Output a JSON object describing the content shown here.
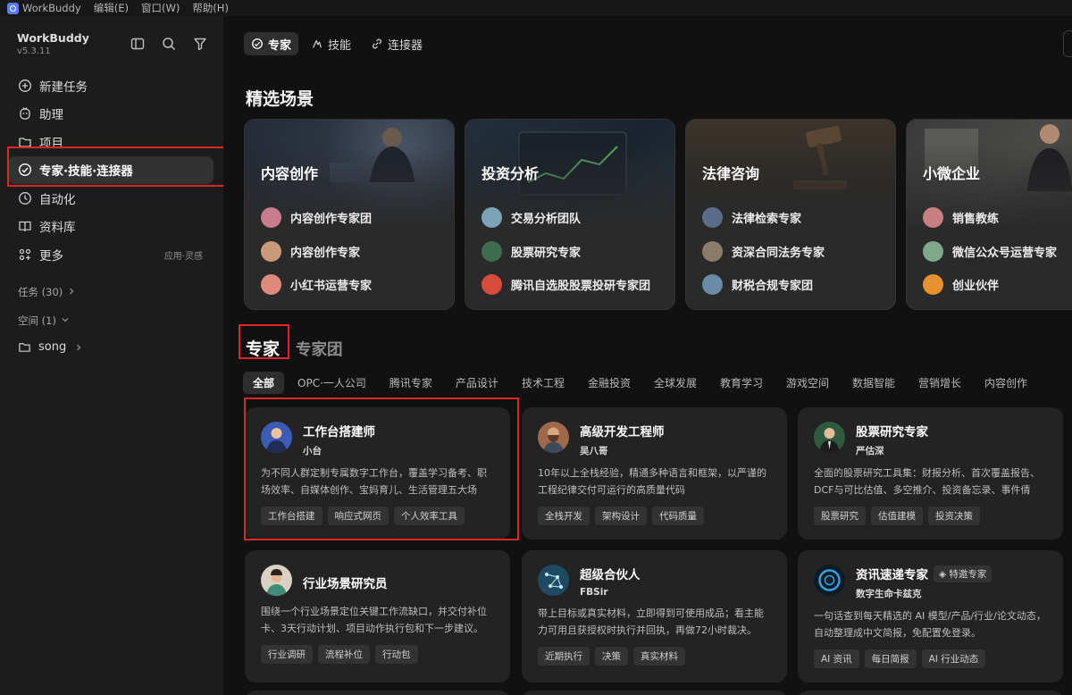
{
  "menubar": {
    "app": "WorkBuddy",
    "items": [
      "编辑(E)",
      "窗口(W)",
      "帮助(H)"
    ]
  },
  "sidebar": {
    "brand": "WorkBuddy",
    "version": "v5.3.11",
    "nav": [
      {
        "label": "新建任务",
        "icon": "plus-circle-icon"
      },
      {
        "label": "助理",
        "icon": "assistant-icon"
      },
      {
        "label": "项目",
        "icon": "folder-icon"
      },
      {
        "label": "专家·技能·连接器",
        "icon": "expert-icon",
        "active": true
      },
      {
        "label": "自动化",
        "icon": "clock-icon"
      },
      {
        "label": "资料库",
        "icon": "book-icon"
      },
      {
        "label": "更多",
        "icon": "grid-icon",
        "extra": "应用·灵感"
      }
    ],
    "tasks_label": "任务 (30)",
    "spaces_label": "空间 (1)",
    "folder": "song"
  },
  "tabs": [
    {
      "label": "专家",
      "active": true
    },
    {
      "label": "技能"
    },
    {
      "label": "连接器"
    }
  ],
  "featured_heading": "精选场景",
  "scenes": [
    {
      "title": "内容创作",
      "rows": [
        "内容创作专家团",
        "内容创作专家",
        "小红书运营专家"
      ],
      "colors": [
        "#c77d8d",
        "#c99a7a",
        "#e08a7a"
      ]
    },
    {
      "title": "投资分析",
      "rows": [
        "交易分析团队",
        "股票研究专家",
        "腾讯自选股股票投研专家团"
      ],
      "colors": [
        "#7da3b8",
        "#3f6b4e",
        "#d84a3a"
      ]
    },
    {
      "title": "法律咨询",
      "rows": [
        "法律检索专家",
        "资深合同法务专家",
        "财税合规专家团"
      ],
      "colors": [
        "#5a6d88",
        "#8b7b6a",
        "#6b8aa8"
      ]
    },
    {
      "title": "小微企业",
      "rows": [
        "销售教练",
        "微信公众号运营专家",
        "创业伙伴"
      ],
      "colors": [
        "#c87f7f",
        "#7ea88a",
        "#e6912e"
      ]
    }
  ],
  "experts_heading": "专家",
  "teams_heading": "专家团",
  "categories": [
    "全部",
    "OPC·一人公司",
    "腾讯专家",
    "产品设计",
    "技术工程",
    "金融投资",
    "全球发展",
    "教育学习",
    "游戏空间",
    "数据智能",
    "营销增长",
    "内容创作"
  ],
  "cards": [
    {
      "name": "工作台搭建师",
      "sub": "小台",
      "desc": "为不同人群定制专属数字工作台，覆盖学习备考、职场效率、自媒体创作、宝妈育儿、生活管理五大场景，…",
      "tags": [
        "工作台搭建",
        "响应式网页",
        "个人效率工具"
      ],
      "avatar_color": "#3b5bb5"
    },
    {
      "name": "高级开发工程师",
      "sub": "吴八哥",
      "desc": "10年以上全栈经验，精通多种语言和框架，以严谨的工程纪律交付可运行的高质量代码",
      "tags": [
        "全栈开发",
        "架构设计",
        "代码质量"
      ],
      "avatar_color": "#a0694a"
    },
    {
      "name": "股票研究专家",
      "sub": "严估深",
      "desc": "全面的股票研究工具集：财报分析、首次覆盖报告、DCF与可比估值、多空推介、投资备忘录、事件倩景…",
      "tags": [
        "股票研究",
        "估值建模",
        "投资决策"
      ],
      "avatar_color": "#2f5a40"
    },
    {
      "name": "行业场景研究员",
      "sub": "",
      "desc": "围绕一个行业场景定位关键工作流缺口，并交付补位卡、3天行动计划、项目动作执行包和下一步建议。",
      "tags": [
        "行业调研",
        "流程补位",
        "行动包"
      ],
      "avatar_color": "#3f8c7a"
    },
    {
      "name": "超级合伙人",
      "sub": "FBSir",
      "desc": "带上目标或真实材料，立即得到可使用成品；看主能力可用且获授权时执行并回执，再做72小时裁决。",
      "tags": [
        "近期执行",
        "决策",
        "真实材料"
      ],
      "avatar_color": "#1f4a63"
    },
    {
      "name": "资讯速递专家",
      "sub": "数字生命卡兹克",
      "badge": "特邀专家",
      "desc": "一句话查到每天精选的 AI 模型/产品/行业/论文动态，自动整理成中文简报，免配置免登录。",
      "tags": [
        "AI 资讯",
        "每日简报",
        "AI 行业动态"
      ],
      "avatar_color": "#1f6a9a"
    }
  ]
}
